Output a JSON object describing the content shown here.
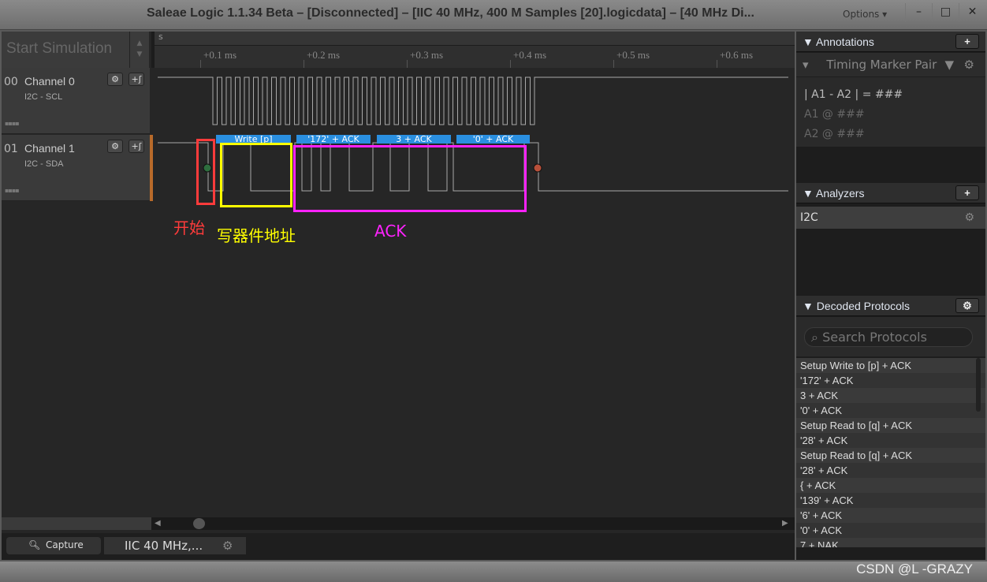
{
  "window": {
    "title": "Saleae Logic 1.1.34 Beta – [Disconnected] – [IIC 40 MHz, 400 M Samples [20].logicdata] – [40 MHz Di...",
    "options": "Options ▾",
    "minimize": "–",
    "maximize": "□",
    "close": "✕"
  },
  "toolbar": {
    "start_simulation": "Start Simulation"
  },
  "ruler": {
    "unit": "s",
    "ticks": [
      "+0.1 ms",
      "+0.2 ms",
      "+0.3 ms",
      "+0.4 ms",
      "+0.5 ms",
      "+0.6 ms"
    ]
  },
  "channels": [
    {
      "num": "00",
      "name": "Channel 0",
      "sub": "I2C - SCL"
    },
    {
      "num": "01",
      "name": "Channel 1",
      "sub": "I2C - SDA"
    }
  ],
  "decoded_segments": [
    "Write [p]",
    "'172' + ACK",
    "3 + ACK",
    "'0' + ACK"
  ],
  "annotations_overlay": {
    "start": "开始",
    "write_addr": "写器件地址",
    "ack": "ACK",
    "colors": {
      "start": "#ff3b3b",
      "write_addr": "#ffff00",
      "ack": "#ff22ff"
    }
  },
  "bottom_tabs": {
    "capture": "Capture",
    "session": "IIC 40 MHz,..."
  },
  "annotations_panel": {
    "title": "Annotations",
    "add": "+",
    "marker_type": "Timing Marker Pair",
    "formula": "| A1 - A2 | = ###",
    "a1": "A1  @  ###",
    "a2": "A2  @  ###"
  },
  "analyzers_panel": {
    "title": "Analyzers",
    "add": "+",
    "items": [
      "I2C"
    ]
  },
  "decoded_panel": {
    "title": "Decoded Protocols",
    "search_placeholder": "Search Protocols",
    "items": [
      "Setup Write to [p] + ACK",
      "'172' + ACK",
      "3 + ACK",
      "'0' + ACK",
      "Setup Read to [q] + ACK",
      "'28' + ACK",
      "Setup Read to [q] + ACK",
      "'28' + ACK",
      "{ + ACK",
      "'139' + ACK",
      "'6' + ACK",
      "'0' + ACK",
      "7 + NAK"
    ]
  },
  "watermark": "CSDN @L -GRAZY",
  "colors": {
    "accent": "#2a8fe0",
    "trace": "#b0b0b0"
  }
}
